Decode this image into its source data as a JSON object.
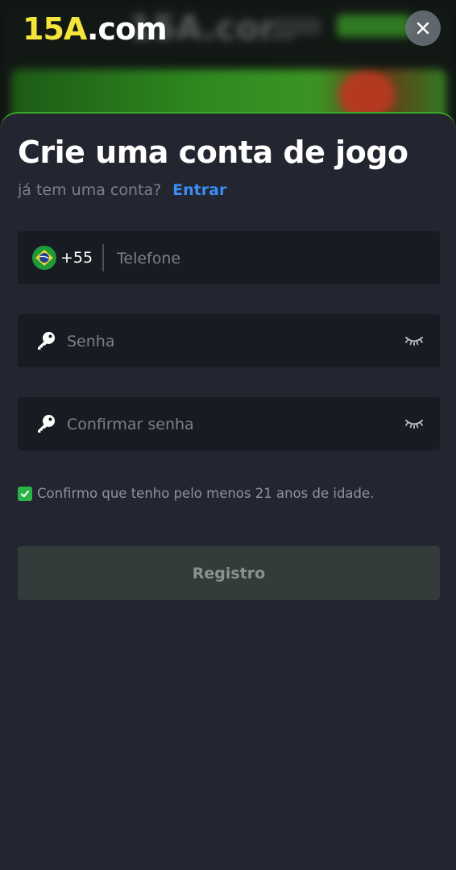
{
  "header": {
    "logo_part1": "15A",
    "logo_part2": ".com",
    "close_icon": "close-icon"
  },
  "background": {
    "logo_ghost": "15A.com"
  },
  "form": {
    "title": "Crie uma conta de jogo",
    "have_account_text": "já tem uma conta?",
    "login_link": "Entrar",
    "phone": {
      "flag_icon": "brazil-flag-icon",
      "dial_code": "+55",
      "placeholder": "Telefone",
      "value": ""
    },
    "password": {
      "icon": "key-icon",
      "placeholder": "Senha",
      "value": "",
      "visibility_icon": "eye-closed-icon"
    },
    "confirm_password": {
      "icon": "key-icon",
      "placeholder": "Confirmar senha",
      "value": "",
      "visibility_icon": "eye-closed-icon"
    },
    "age_confirm": {
      "checked": true,
      "label": "Confirmo que tenho pelo menos 21 anos de idade."
    },
    "submit_label": "Registro"
  },
  "colors": {
    "accent_green": "#3aa62a",
    "link_blue": "#3c8df2",
    "logo_yellow": "#f3e53a",
    "sheet_bg": "#232630",
    "field_bg": "#181b22",
    "checkbox_green": "#2bb34a"
  }
}
